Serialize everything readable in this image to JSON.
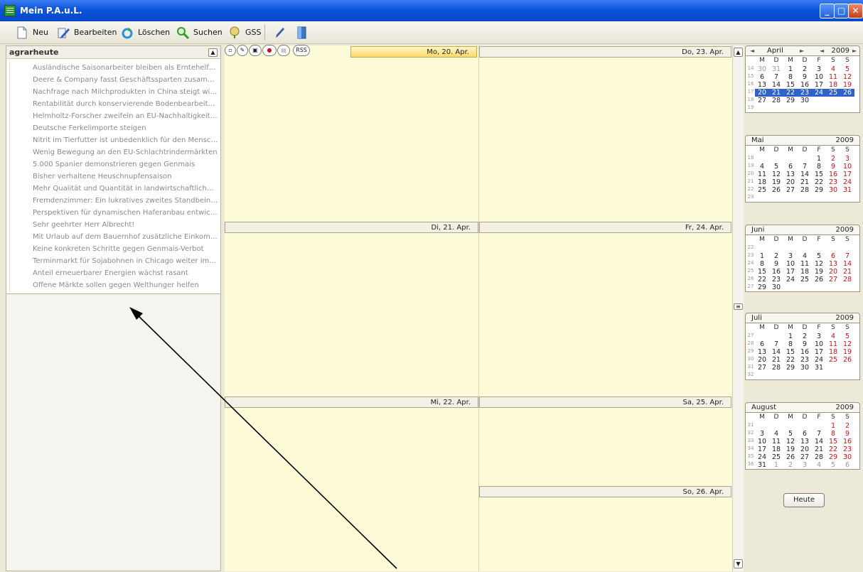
{
  "window": {
    "title": "Mein P.A.u.L."
  },
  "toolbar": {
    "new_label": "Neu",
    "edit_label": "Bearbeiten",
    "delete_label": "Löschen",
    "search_label": "Suchen",
    "gss_label": "GSS"
  },
  "feed": {
    "title": "agrarheute",
    "items": [
      "Ausländische Saisonarbeiter bleiben als Erntehelfer un...",
      "Deere & Company fasst Geschäftssparten zusammen",
      "Nachfrage nach Milchprodukten in China steigt wieder",
      "Rentabilität durch konservierende Bodenbearbeitung ...",
      "Helmholtz-Forscher zweifeln an EU-Nachhaltigkeitssta...",
      "Deutsche Ferkelimporte steigen",
      "Nitrit im Tierfutter ist unbedenklich für den Menschen",
      "Wenig Bewegung an den EU-Schlachtrindermärkten",
      "5.000 Spanier demonstrieren gegen Genmais",
      "Bisher verhaltene Heuschnupfensaison",
      "Mehr Qualität und Quantität in landwirtschaftlicher Pr...",
      "Fremdenzimmer: Ein lukratives zweites Standbein für ...",
      "Perspektiven für dynamischen Haferanbau entwickelt",
      "Sehr geehrter Herr Albrecht!",
      "Mit Urlaub auf dem Bauernhof zusätzliche Einkommens...",
      "Keine konkreten Schritte gegen Genmais-Verbot",
      "Terminmarkt für Sojabohnen in Chicago weiter im Auf...",
      "Anteil erneuerbarer Energien wächst rasant",
      "Offene Märkte sollen gegen Welthunger helfen"
    ]
  },
  "week": {
    "rss_label": "RSS",
    "days": {
      "mon": "Mo, 20. Apr.",
      "tue": "Di, 21. Apr.",
      "wed": "Mi, 22. Apr.",
      "thu": "Do, 23. Apr.",
      "fri": "Fr, 24. Apr.",
      "sat": "Sa, 25. Apr.",
      "sun": "So, 26. Apr."
    }
  },
  "calendar": {
    "weekday_labels": [
      "M",
      "D",
      "M",
      "D",
      "F",
      "S",
      "S"
    ],
    "today_label": "Heute",
    "nav": {
      "prev": "◄",
      "next": "►"
    },
    "months": [
      {
        "name": "April",
        "year": "2009",
        "weeks": [
          14,
          15,
          16,
          17,
          18,
          19
        ],
        "rows": [
          [
            "30",
            "31",
            "1",
            "2",
            "3",
            "4",
            "5"
          ],
          [
            "6",
            "7",
            "8",
            "9",
            "10",
            "11",
            "12"
          ],
          [
            "13",
            "14",
            "15",
            "16",
            "17",
            "18",
            "19"
          ],
          [
            "20",
            "21",
            "22",
            "23",
            "24",
            "25",
            "26"
          ],
          [
            "27",
            "28",
            "29",
            "30",
            "",
            "",
            ""
          ],
          [
            "",
            "",
            "",
            "",
            "",
            "",
            ""
          ]
        ],
        "selected_row": 3,
        "other_month": [
          [
            0,
            0
          ],
          [
            0,
            1
          ]
        ]
      },
      {
        "name": "Mai",
        "year": "2009",
        "weeks": [
          18,
          19,
          20,
          21,
          22,
          23
        ],
        "rows": [
          [
            "",
            "",
            "",
            "",
            "1",
            "2",
            "3"
          ],
          [
            "4",
            "5",
            "6",
            "7",
            "8",
            "9",
            "10"
          ],
          [
            "11",
            "12",
            "13",
            "14",
            "15",
            "16",
            "17"
          ],
          [
            "18",
            "19",
            "20",
            "21",
            "22",
            "23",
            "24"
          ],
          [
            "25",
            "26",
            "27",
            "28",
            "29",
            "30",
            "31"
          ],
          [
            "",
            "",
            "",
            "",
            "",
            "",
            ""
          ]
        ],
        "selected_row": -1,
        "other_month": []
      },
      {
        "name": "Juni",
        "year": "2009",
        "weeks": [
          22,
          23,
          24,
          25,
          26,
          27
        ],
        "rows": [
          [
            "",
            "",
            "",
            "",
            "",
            "",
            ""
          ],
          [
            "1",
            "2",
            "3",
            "4",
            "5",
            "6",
            "7"
          ],
          [
            "8",
            "9",
            "10",
            "11",
            "12",
            "13",
            "14"
          ],
          [
            "15",
            "16",
            "17",
            "18",
            "19",
            "20",
            "21"
          ],
          [
            "22",
            "23",
            "24",
            "25",
            "26",
            "27",
            "28"
          ],
          [
            "29",
            "30",
            "",
            "",
            "",
            "",
            ""
          ]
        ],
        "selected_row": -1,
        "other_month": []
      },
      {
        "name": "Juli",
        "year": "2009",
        "weeks": [
          27,
          28,
          29,
          30,
          31,
          32
        ],
        "rows": [
          [
            "",
            "",
            "1",
            "2",
            "3",
            "4",
            "5"
          ],
          [
            "6",
            "7",
            "8",
            "9",
            "10",
            "11",
            "12"
          ],
          [
            "13",
            "14",
            "15",
            "16",
            "17",
            "18",
            "19"
          ],
          [
            "20",
            "21",
            "22",
            "23",
            "24",
            "25",
            "26"
          ],
          [
            "27",
            "28",
            "29",
            "30",
            "31",
            "",
            ""
          ],
          [
            "",
            "",
            "",
            "",
            "",
            "",
            ""
          ]
        ],
        "selected_row": -1,
        "other_month": []
      },
      {
        "name": "August",
        "year": "2009",
        "weeks": [
          31,
          32,
          33,
          34,
          35,
          36
        ],
        "rows": [
          [
            "",
            "",
            "",
            "",
            "",
            "1",
            "2"
          ],
          [
            "3",
            "4",
            "5",
            "6",
            "7",
            "8",
            "9"
          ],
          [
            "10",
            "11",
            "12",
            "13",
            "14",
            "15",
            "16"
          ],
          [
            "17",
            "18",
            "19",
            "20",
            "21",
            "22",
            "23"
          ],
          [
            "24",
            "25",
            "26",
            "27",
            "28",
            "29",
            "30"
          ],
          [
            "31",
            "1",
            "2",
            "3",
            "4",
            "5",
            "6"
          ]
        ],
        "selected_row": -1,
        "other_month": [
          [
            5,
            1
          ],
          [
            5,
            2
          ],
          [
            5,
            3
          ],
          [
            5,
            4
          ],
          [
            5,
            5
          ],
          [
            5,
            6
          ]
        ]
      }
    ]
  },
  "colors": {
    "accent": "#2f63c9",
    "weekend": "#cc1111",
    "week_bg": "#fefbd8",
    "annotation": "#000000"
  }
}
